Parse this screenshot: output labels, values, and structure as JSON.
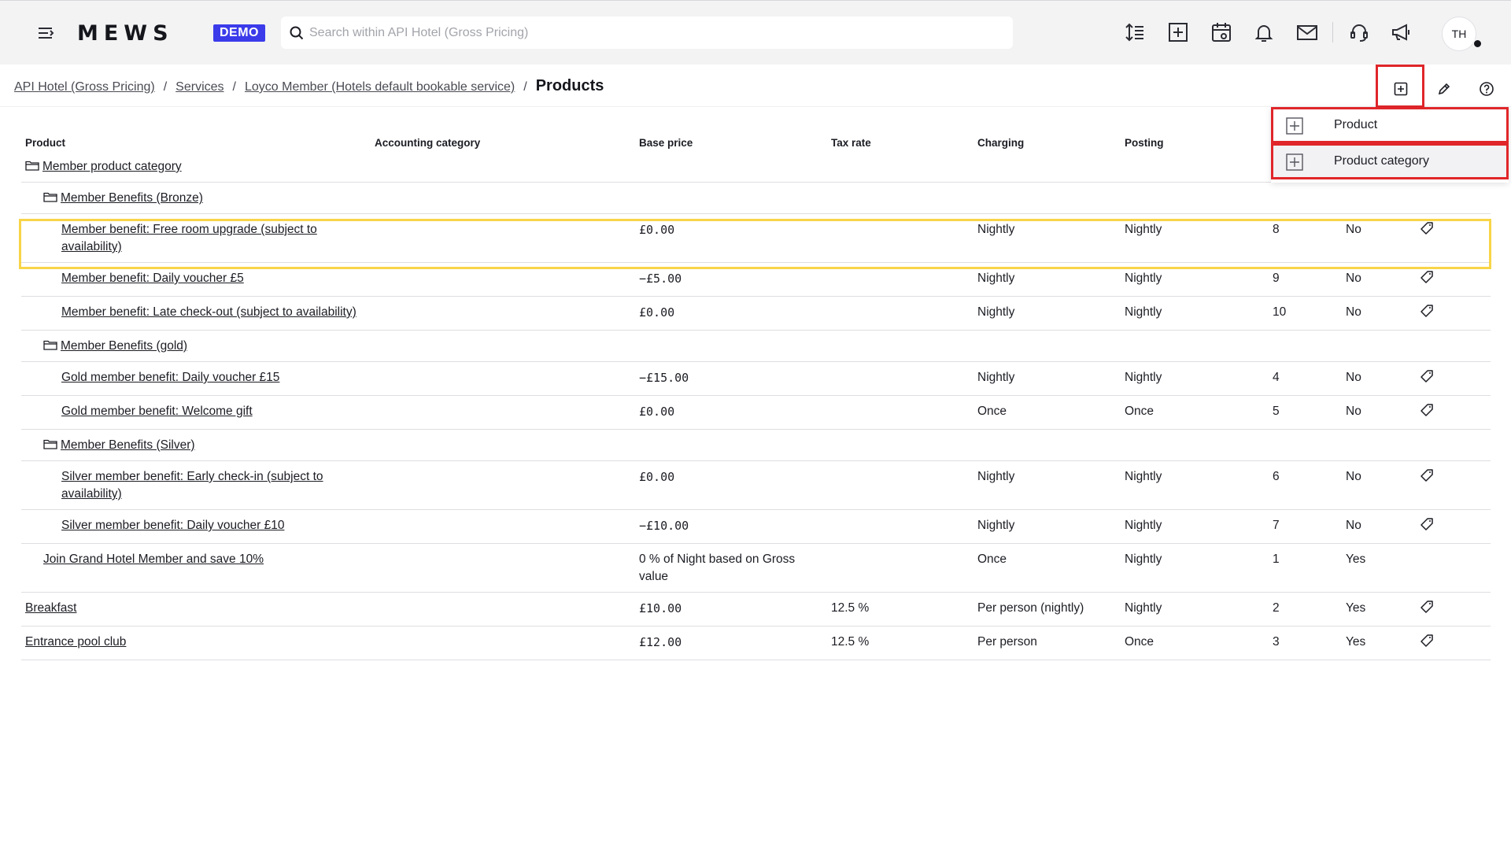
{
  "header": {
    "logo": "MEWS",
    "demo_badge": "DEMO",
    "search_placeholder": "Search within API Hotel (Gross Pricing)",
    "search_value": "",
    "avatar_initials": "TH"
  },
  "breadcrumb": {
    "items": [
      "API Hotel (Gross Pricing)",
      "Services",
      "Loyco Member (Hotels default bookable service)"
    ],
    "separator": "/",
    "current": "Products"
  },
  "add_menu": {
    "items": [
      {
        "label": "Product"
      },
      {
        "label": "Product category"
      }
    ]
  },
  "table": {
    "columns": [
      "Product",
      "Accounting category",
      "Base price",
      "Tax rate",
      "Charging",
      "Posting",
      "",
      "",
      ""
    ],
    "rows": [
      {
        "type": "category",
        "level": 0,
        "name": "Member product category"
      },
      {
        "type": "category",
        "level": 1,
        "name": "Member Benefits (Bronze)"
      },
      {
        "type": "product",
        "level": 2,
        "name": "Member benefit: Free room upgrade (subject to availability)",
        "accounting": "",
        "price": "£0.00",
        "tax": "",
        "charging": "Nightly",
        "posting": "Nightly",
        "order": "8",
        "flag": "No",
        "tag": true,
        "highlighted": true
      },
      {
        "type": "product",
        "level": 2,
        "name": "Member benefit: Daily voucher £5",
        "accounting": "",
        "price": "−£5.00",
        "tax": "",
        "charging": "Nightly",
        "posting": "Nightly",
        "order": "9",
        "flag": "No",
        "tag": true
      },
      {
        "type": "product",
        "level": 2,
        "name": "Member benefit: Late check-out (subject to availability)",
        "accounting": "",
        "price": "£0.00",
        "tax": "",
        "charging": "Nightly",
        "posting": "Nightly",
        "order": "10",
        "flag": "No",
        "tag": true
      },
      {
        "type": "category",
        "level": 1,
        "name": "Member Benefits (gold)"
      },
      {
        "type": "product",
        "level": 2,
        "name": "Gold member benefit: Daily voucher £15",
        "accounting": "",
        "price": "−£15.00",
        "tax": "",
        "charging": "Nightly",
        "posting": "Nightly",
        "order": "4",
        "flag": "No",
        "tag": true
      },
      {
        "type": "product",
        "level": 2,
        "name": "Gold member benefit: Welcome gift",
        "accounting": "",
        "price": "£0.00",
        "tax": "",
        "charging": "Once",
        "posting": "Once",
        "order": "5",
        "flag": "No",
        "tag": true
      },
      {
        "type": "category",
        "level": 1,
        "name": "Member Benefits (Silver)"
      },
      {
        "type": "product",
        "level": 2,
        "name": "Silver member benefit: Early check-in (subject to availability)",
        "accounting": "",
        "price": "£0.00",
        "tax": "",
        "charging": "Nightly",
        "posting": "Nightly",
        "order": "6",
        "flag": "No",
        "tag": true
      },
      {
        "type": "product",
        "level": 2,
        "name": "Silver member benefit: Daily voucher £10",
        "accounting": "",
        "price": "−£10.00",
        "tax": "",
        "charging": "Nightly",
        "posting": "Nightly",
        "order": "7",
        "flag": "No",
        "tag": true
      },
      {
        "type": "product",
        "level": 1,
        "name": "Join Grand Hotel Member and save 10%",
        "accounting": "",
        "price": "0 % of Night based on Gross value",
        "price_mono": false,
        "tax": "",
        "charging": "Once",
        "posting": "Nightly",
        "order": "1",
        "flag": "Yes",
        "tag": false
      },
      {
        "type": "product",
        "level": 0,
        "name": "Breakfast",
        "accounting": "",
        "price": "£10.00",
        "tax": "12.5 %",
        "charging": "Per person (nightly)",
        "posting": "Nightly",
        "order": "2",
        "flag": "Yes",
        "tag": true
      },
      {
        "type": "product",
        "level": 0,
        "name": "Entrance pool club",
        "accounting": "",
        "price": "£12.00",
        "tax": "12.5 %",
        "charging": "Per person",
        "posting": "Once",
        "order": "3",
        "flag": "Yes",
        "tag": true
      }
    ]
  },
  "colors": {
    "accent": "#3b3bea",
    "highlight_red": "#e0262a",
    "highlight_yellow": "#f8d548",
    "topbar_bg": "#f3f3f4"
  }
}
